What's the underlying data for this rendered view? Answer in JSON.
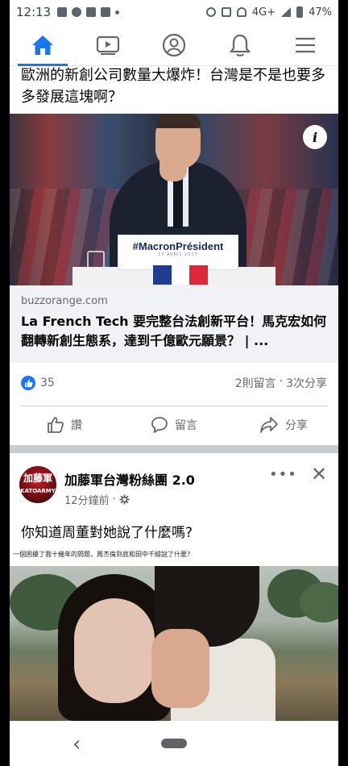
{
  "status_bar": {
    "time": "12:13",
    "network": "4G+",
    "battery": "47%"
  },
  "nav": {
    "tabs": [
      {
        "icon": "home-icon",
        "active": true
      },
      {
        "icon": "video-icon",
        "active": false
      },
      {
        "icon": "profile-icon",
        "active": false
      },
      {
        "icon": "bell-icon",
        "active": false
      },
      {
        "icon": "menu-icon",
        "active": false
      }
    ],
    "accent": "#1877f2"
  },
  "post1": {
    "headline": "歐洲的新創公司數量大爆炸！台灣是不是也要多多發展這塊啊？",
    "image": {
      "sign_text": "#MacronPrésident",
      "sign_date": "17 AVRIL 2017",
      "info_icon": "info-icon"
    },
    "link": {
      "domain": "buzzorange.com",
      "title": "La French Tech 要完整台法創新平台！馬克宏如何翻轉新創生態系，達到千億歐元願景？ | ..."
    },
    "likes": "35",
    "comments": "2則留言",
    "separator": "·",
    "shares": "3次分享",
    "actions": {
      "like": "讚",
      "comment": "留言",
      "share": "分享"
    }
  },
  "post2": {
    "page_name": "加藤軍台灣粉絲團 2.0",
    "avatar_text": "加藤軍",
    "avatar_subtext": "KATOARMY",
    "time": "12分鐘前",
    "dot": "·",
    "text": "你知道周董對她說了什麼嗎?",
    "image_caption": "一個困擾了我十幾年的問題，周杰倫到底和田中千繪說了什麼?"
  }
}
